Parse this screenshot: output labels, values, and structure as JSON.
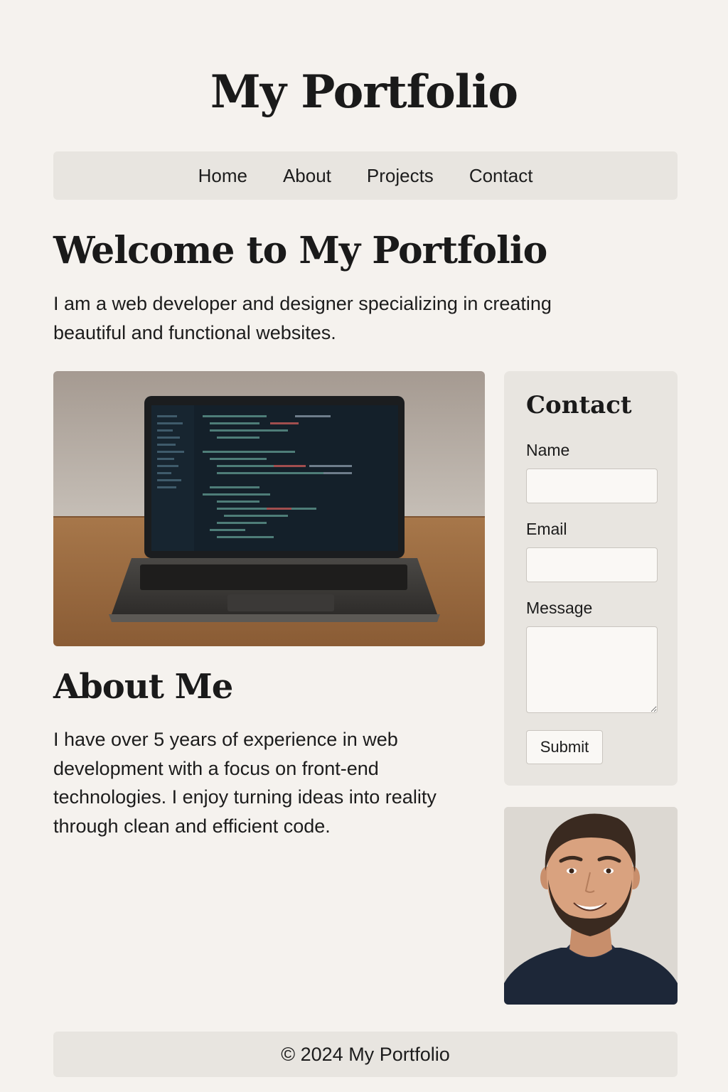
{
  "site": {
    "title": "My Portfolio"
  },
  "nav": {
    "items": [
      "Home",
      "About",
      "Projects",
      "Contact"
    ]
  },
  "welcome": {
    "heading": "Welcome to My Portfolio",
    "text": "I am a web developer and designer specializing in creating beautiful and functional websites."
  },
  "about": {
    "heading": "About Me",
    "text": "I have over 5 years of experience in web development with a focus on front-end technologies. I enjoy turning ideas into reality through clean and efficient code."
  },
  "contact": {
    "heading": "Contact",
    "name_label": "Name",
    "name_value": "",
    "email_label": "Email",
    "email_value": "",
    "message_label": "Message",
    "message_value": "",
    "submit_label": "Submit"
  },
  "footer": {
    "text": "© 2024 My Portfolio"
  },
  "images": {
    "hero": "laptop-with-code-editor",
    "portrait": "smiling-man-headshot"
  },
  "colors": {
    "page_background": "#f5f2ee",
    "panel_background": "#e8e5e0",
    "text": "#1c1c1c"
  }
}
